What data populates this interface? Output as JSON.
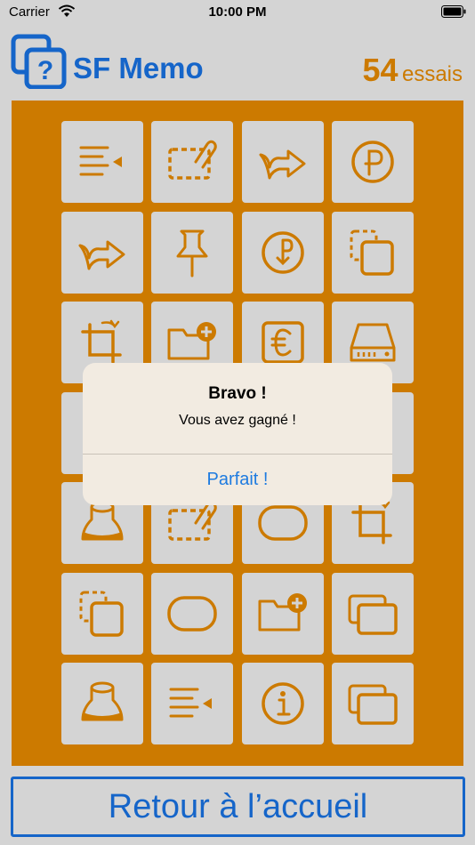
{
  "status_bar": {
    "carrier": "Carrier",
    "time": "10:00 PM"
  },
  "header": {
    "title": "SF Memo",
    "tries_count": "54",
    "tries_label": "essais"
  },
  "board": {
    "rows": [
      [
        "text-indent-icon",
        "clipboard-attachment-icon",
        "share-arrows-icon",
        "ruble-circle-icon"
      ],
      [
        "share-arrows-icon",
        "pushpin-icon",
        "ruble-circle-down-icon",
        "copy-icon"
      ],
      [
        "crop-rotate-icon",
        "folder-add-icon",
        "euro-square-icon",
        "hard-drive-icon"
      ],
      [
        "hidden",
        "hidden",
        "hidden",
        "hidden"
      ],
      [
        "cone-cup-icon",
        "clipboard-attachment-icon",
        "rounded-rectangle-icon",
        "crop-rotate-icon"
      ],
      [
        "copy-icon",
        "rounded-rectangle-icon",
        "folder-add-icon",
        "stacked-windows-icon"
      ],
      [
        "cone-cup-icon",
        "text-indent-icon",
        "info-circle-icon",
        "stacked-windows-icon"
      ]
    ]
  },
  "alert": {
    "title": "Bravo !",
    "message": "Vous avez gagné !",
    "button": "Parfait !"
  },
  "footer": {
    "home_button": "Retour à l’accueil"
  },
  "colors": {
    "accent_orange": "#cc7a00",
    "brand_blue": "#1565c9",
    "background": "#d4d4d4",
    "alert_bg": "#f2ebe1"
  }
}
